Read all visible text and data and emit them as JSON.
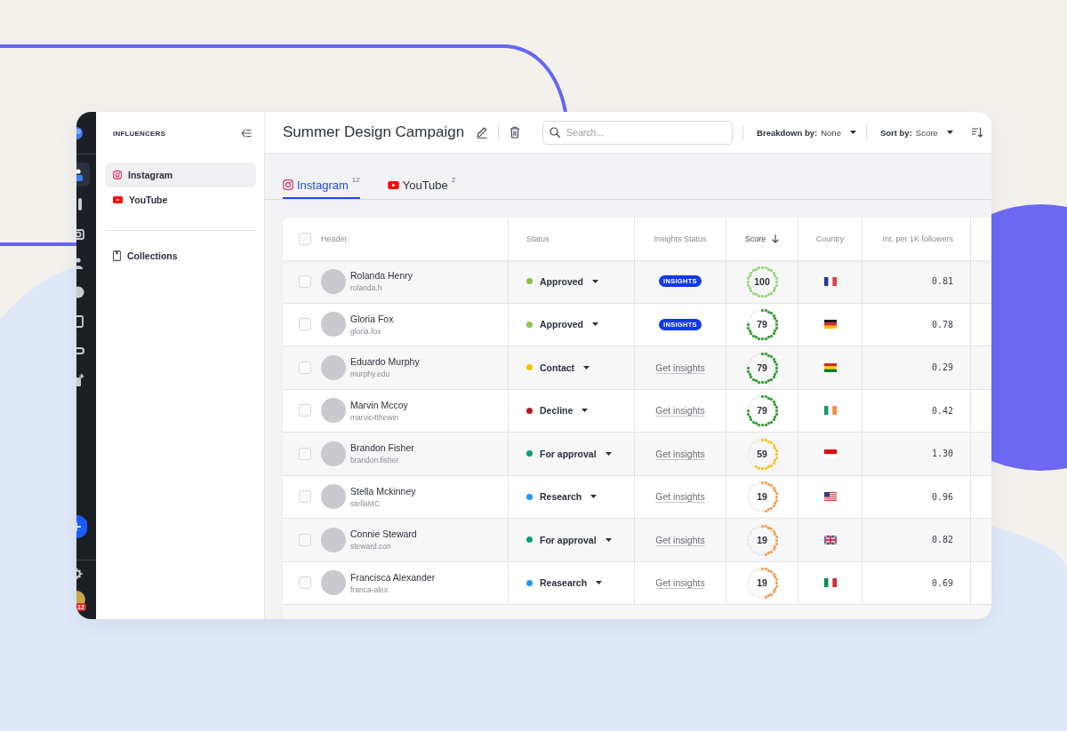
{
  "rail": {
    "items": [
      {
        "kind": "user",
        "selected": true
      },
      {
        "kind": "bar",
        "selected": false
      },
      {
        "kind": "camera",
        "selected": false
      },
      {
        "kind": "people",
        "selected": false
      },
      {
        "kind": "disc",
        "selected": false
      },
      {
        "kind": "square",
        "selected": false
      },
      {
        "kind": "pill",
        "selected": false
      },
      {
        "kind": "file-plus",
        "selected": false
      }
    ],
    "badge": "12"
  },
  "sidebar": {
    "title": "INFLUENCERS",
    "items": [
      {
        "label": "Instagram",
        "kind": "instagram",
        "selected": true
      },
      {
        "label": "YouTube",
        "kind": "youtube",
        "selected": false
      }
    ],
    "collections": {
      "label": "Collections",
      "selected": false
    }
  },
  "header": {
    "title": "Summer Design Campaign",
    "search": {
      "placeholder": "Search..."
    },
    "breakdown": {
      "label": "Breakdown by:",
      "value": "None"
    },
    "sort": {
      "label": "Sort by:",
      "value": "Score"
    }
  },
  "tabs": [
    {
      "label": "Instagram",
      "kind": "instagram",
      "count": "12",
      "selected": true
    },
    {
      "label": "YouTube",
      "kind": "youtube",
      "count": "2",
      "selected": false
    }
  ],
  "table": {
    "select_all": {
      "checked": false
    },
    "columns": [
      {
        "label": "Header",
        "sorted": false
      },
      {
        "label": "Status",
        "sorted": false
      },
      {
        "label": "Insights Status",
        "sorted": false
      },
      {
        "label": "Score",
        "sorted": true
      },
      {
        "label": "Country",
        "sorted": false
      },
      {
        "label": "Int. per 1K followers",
        "sorted": false
      }
    ],
    "rows": [
      {
        "checked": false,
        "name": "Rolanda Henry",
        "handle": "rolanda.h",
        "status": {
          "label": "Approved",
          "color": "#8bc34a"
        },
        "insights": {
          "kind": "badge",
          "label": "INSIGHTS"
        },
        "score": {
          "value": "100",
          "kind": "full",
          "color": "#9ad87a"
        },
        "country": {
          "kind": "fr"
        },
        "int_per_1k": "0.81"
      },
      {
        "checked": false,
        "name": "Gloria Fox",
        "handle": "gloria.fox",
        "status": {
          "label": "Approved",
          "color": "#8bc34a"
        },
        "insights": {
          "kind": "badge",
          "label": "INSIGHTS"
        },
        "score": {
          "value": "79",
          "kind": "high",
          "color": "#3b9e3b"
        },
        "country": {
          "kind": "de"
        },
        "int_per_1k": "0.78"
      },
      {
        "checked": false,
        "name": "Eduardo Murphy",
        "handle": "murphy.edu",
        "status": {
          "label": "Contact",
          "color": "#f5c000"
        },
        "insights": {
          "kind": "link",
          "label": "Get insights"
        },
        "score": {
          "value": "79",
          "kind": "high",
          "color": "#3b9e3b"
        },
        "country": {
          "kind": "bo"
        },
        "int_per_1k": "0.29"
      },
      {
        "checked": false,
        "name": "Marvin Mccoy",
        "handle": "marvic4thewin",
        "status": {
          "label": "Decline",
          "color": "#b71c1c"
        },
        "insights": {
          "kind": "link",
          "label": "Get insights"
        },
        "score": {
          "value": "79",
          "kind": "high",
          "color": "#3b9e3b"
        },
        "country": {
          "kind": "ie"
        },
        "int_per_1k": "0.42"
      },
      {
        "checked": false,
        "name": "Brandon Fisher",
        "handle": "brandon.fisher",
        "status": {
          "label": "For approval",
          "color": "#0f9d7a"
        },
        "insights": {
          "kind": "link",
          "label": "Get insights"
        },
        "score": {
          "value": "59",
          "kind": "mid",
          "color": "#f6c428"
        },
        "country": {
          "kind": "id"
        },
        "int_per_1k": "1.30"
      },
      {
        "checked": false,
        "name": "Stella Mckinney",
        "handle": "stellaMC",
        "status": {
          "label": "Research",
          "color": "#2196f3"
        },
        "insights": {
          "kind": "link",
          "label": "Get insights"
        },
        "score": {
          "value": "19",
          "kind": "low",
          "color": "#f5a05a"
        },
        "country": {
          "kind": "us"
        },
        "int_per_1k": "0.96"
      },
      {
        "checked": false,
        "name": "Connie Steward",
        "handle": "steward.con",
        "status": {
          "label": "For approval",
          "color": "#0f9d7a"
        },
        "insights": {
          "kind": "link",
          "label": "Get insights"
        },
        "score": {
          "value": "19",
          "kind": "low",
          "color": "#f5a05a"
        },
        "country": {
          "kind": "gb"
        },
        "int_per_1k": "0.82"
      },
      {
        "checked": false,
        "name": "Francisca Alexander",
        "handle": "franca-alex",
        "status": {
          "label": "Reasearch",
          "color": "#2196f3"
        },
        "insights": {
          "kind": "link",
          "label": "Get insights"
        },
        "score": {
          "value": "19",
          "kind": "low",
          "color": "#f5a05a"
        },
        "country": {
          "kind": "it"
        },
        "int_per_1k": "0.69"
      }
    ]
  }
}
